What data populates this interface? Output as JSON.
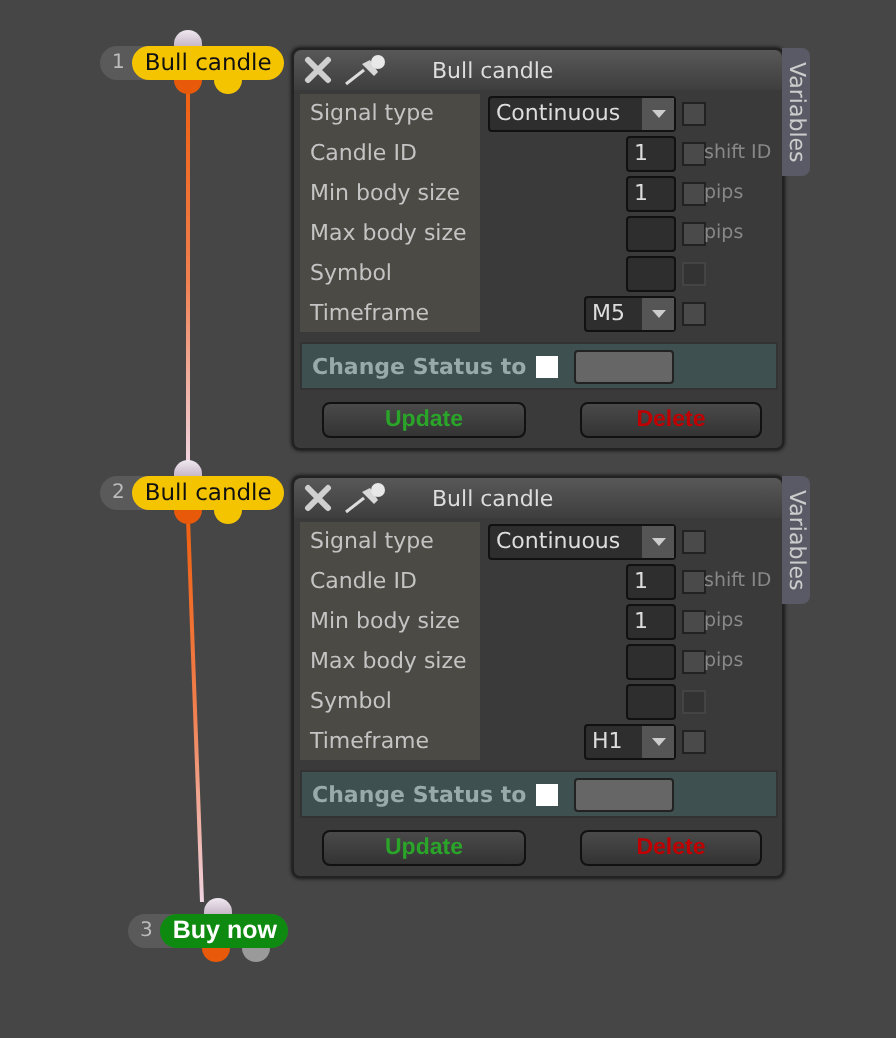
{
  "nodes": [
    {
      "number": "1",
      "label": "Bull candle",
      "color": "#f5c400"
    },
    {
      "number": "2",
      "label": "Bull candle",
      "color": "#f5c400"
    },
    {
      "number": "3",
      "label": "Buy now",
      "color": "#0f8a10"
    }
  ],
  "panels": [
    {
      "title": "Bull candle",
      "side_tab": "Variables",
      "fields": [
        {
          "label": "Signal type",
          "kind": "select",
          "value": "Continuous",
          "checked": false,
          "disabled": false
        },
        {
          "label": "Candle ID",
          "kind": "input",
          "value": "1",
          "checked": false,
          "disabled": false,
          "unit": "shift ID"
        },
        {
          "label": "Min body size",
          "kind": "input",
          "value": "1",
          "checked": false,
          "disabled": false,
          "unit": "pips"
        },
        {
          "label": "Max body size",
          "kind": "input",
          "checked": false,
          "disabled": false,
          "unit": "pips"
        },
        {
          "label": "Symbol",
          "kind": "input",
          "checked": false,
          "disabled": true
        },
        {
          "label": "Timeframe",
          "kind": "smallselect",
          "value": "M5",
          "checked": false,
          "disabled": false
        }
      ],
      "status_label": "Change Status to",
      "status_checked": false,
      "buttons": [
        {
          "label": "Update",
          "kind": "update"
        },
        {
          "label": "Delete",
          "kind": "delete"
        }
      ]
    },
    {
      "title": "Bull candle",
      "side_tab": "Variables",
      "fields": [
        {
          "label": "Signal type",
          "kind": "select",
          "value": "Continuous",
          "checked": false,
          "disabled": false
        },
        {
          "label": "Candle ID",
          "kind": "input",
          "value": "1",
          "checked": false,
          "disabled": false,
          "unit": "shift ID"
        },
        {
          "label": "Min body size",
          "kind": "input",
          "value": "1",
          "checked": false,
          "disabled": false,
          "unit": "pips"
        },
        {
          "label": "Max body size",
          "kind": "input",
          "checked": false,
          "disabled": false,
          "unit": "pips"
        },
        {
          "label": "Symbol",
          "kind": "input",
          "checked": false,
          "disabled": true
        },
        {
          "label": "Timeframe",
          "kind": "smallselect",
          "value": "H1",
          "checked": false,
          "disabled": false
        }
      ],
      "status_label": "Change Status to",
      "status_checked": false,
      "buttons": [
        {
          "label": "Update",
          "kind": "update"
        },
        {
          "label": "Delete",
          "kind": "delete"
        }
      ]
    }
  ]
}
